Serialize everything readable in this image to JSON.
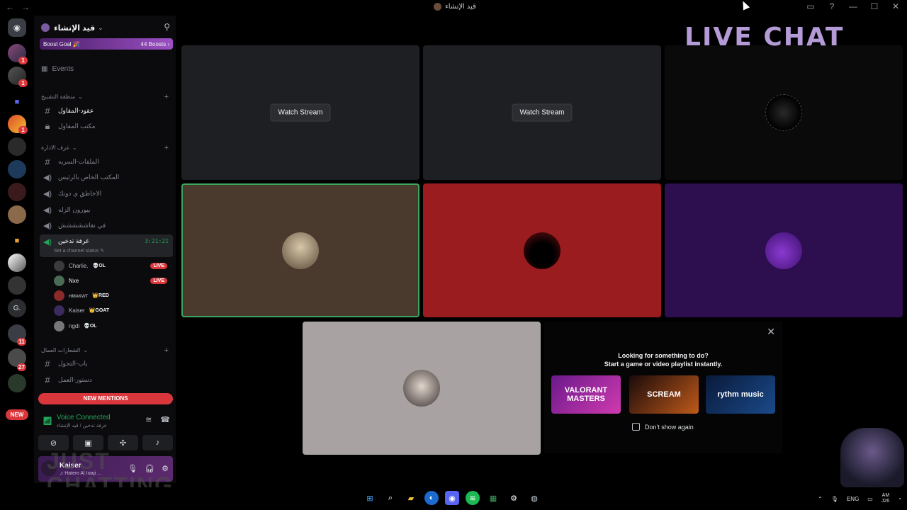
{
  "window": {
    "back": "←",
    "forward": "→",
    "title": "قيد الإنشاء",
    "controls": [
      "▭",
      "?",
      "—",
      "☐",
      "✕"
    ]
  },
  "rail": {
    "badges": [
      "1",
      "1",
      "1",
      "11",
      "27"
    ],
    "letter_server": "G.",
    "new_pill": "NEW"
  },
  "server": {
    "name": "قيد الإنشاء",
    "boost_goal": "Boost Goal 🎉",
    "boosts": "44 Boosts ›",
    "events": "Events"
  },
  "categories": {
    "cat1": "منطقة التشبيح",
    "cat2": "غرف الادارة",
    "cat3": "الشعارات العمال"
  },
  "channels": {
    "c1": "عقود-المقاول",
    "c2": "مكتب المقاول",
    "c3": "الملفات-السريه",
    "c4": "المكتب الخاص بالرئيس",
    "c5": "الاخاطق ي دونك",
    "c6": "بيورون الزله",
    "c7": "في نقاششششش",
    "c8": "غرفة تدخين",
    "c8_timer": "3:21:21",
    "c8_status": "Set a channel status ✎",
    "c9": "باب-التحول",
    "c10": "دستور-العمل"
  },
  "members": [
    {
      "name": "Charlie.",
      "tag": "💀OL",
      "live": "LIVE",
      "color": "#3b3b3b"
    },
    {
      "name": "Nxe",
      "tag": "",
      "live": "LIVE",
      "color": "#4a6b55"
    },
    {
      "name": "ʜᴍᴀᴋᴡᴛ",
      "tag": "👑RED",
      "live": "",
      "color": "#8a2a2a"
    },
    {
      "name": "Kaiser",
      "tag": "👑GOAT",
      "live": "",
      "color": "#3a2a5e"
    },
    {
      "name": "ngdi",
      "tag": "💀OL",
      "live": "",
      "color": "#777777"
    }
  ],
  "new_mentions": "NEW MENTIONS",
  "voice": {
    "status": "Voice Connected",
    "sub": "غرفة تدخين / قيد الإنشاء"
  },
  "user": {
    "name": "Kaiser",
    "sub": "♫ Hatem Al Iraqi ..."
  },
  "overlay": {
    "line1": "JUST",
    "line2": "CHATTING"
  },
  "main": {
    "watch1": "Watch Stream",
    "watch2": "Watch Stream",
    "live_chat": "LIVE CHAT"
  },
  "activity": {
    "line1": "Looking for something to do?",
    "line2": "Start a game or video playlist instantly.",
    "games": [
      "VALORANT MASTERS",
      "SCREAM",
      "rythm music"
    ],
    "dont_show": "Don't show again"
  },
  "tray": {
    "lang": "ENG",
    "time": "AM",
    "date": "J26"
  },
  "colors": {
    "accent_green": "#23a55a",
    "live_red": "#da373c",
    "tile_brown": "#4a3a2e",
    "tile_red": "#9b1c1f",
    "tile_purple": "#2d0e4f",
    "tile_grey": "#a9a2a3"
  }
}
